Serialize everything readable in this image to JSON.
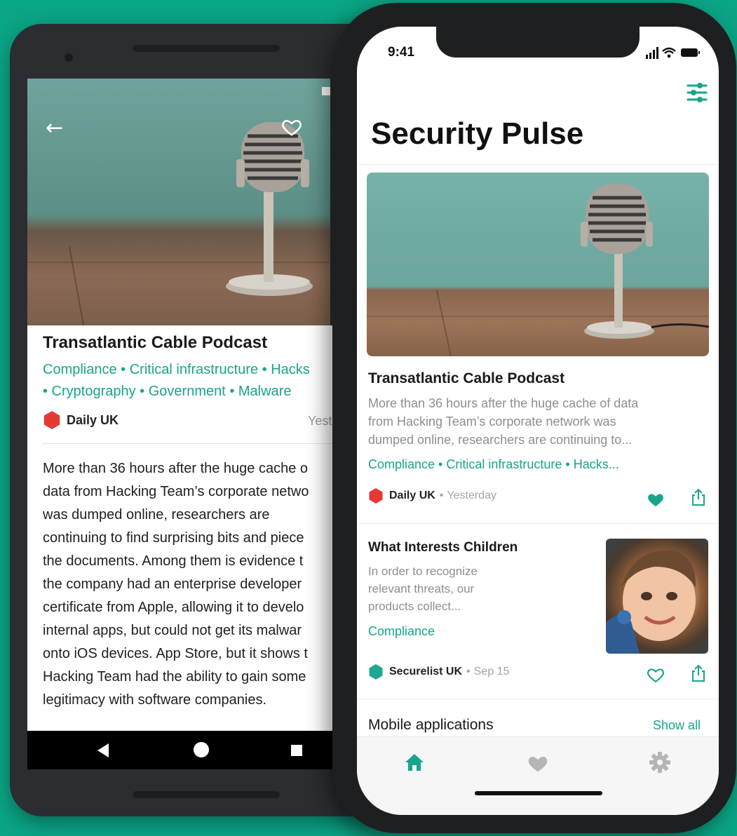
{
  "android": {
    "title": "Transatlantic Cable Podcast",
    "tags": [
      "Compliance • Critical infrastructure • Hacks",
      "• Cryptography • Government • Malware"
    ],
    "source": "Daily UK",
    "date": "Yeste",
    "body": [
      "More than 36 hours after the huge cache o",
      "data from Hacking Team’s corporate netwo",
      "was dumped online, researchers are",
      "continuing to find surprising bits and piece",
      "the documents. Among them is evidence t",
      "the company had an enterprise developer",
      "certificate from Apple, allowing it to develo",
      "internal apps, but could not get its malwar",
      "onto iOS devices. App Store, but it shows t",
      "Hacking Team had the ability to gain some",
      "legitimacy with software companies."
    ]
  },
  "iphone": {
    "status_time": "9:41",
    "app_title": "Security Pulse",
    "card1": {
      "title": "Transatlantic Cable Podcast",
      "desc": [
        "More than 36 hours after the huge cache of data",
        "from Hacking Team’s corporate network was",
        "dumped online, researchers are continuing to..."
      ],
      "tags": "Compliance • Critical infrastructure • Hacks...",
      "source": "Daily UK",
      "date": "Yesterday",
      "liked": true
    },
    "card2": {
      "title": "What Interests Children",
      "desc": [
        "In order to recognize",
        "relevant threats, our",
        "products collect..."
      ],
      "tag": "Compliance",
      "source": "Securelist UK",
      "date": "Sep 15",
      "liked": false
    },
    "section": {
      "title": "Mobile applications",
      "action": "Show all"
    },
    "tabs": [
      "home-icon",
      "heart-icon",
      "gear-icon"
    ]
  },
  "colors": {
    "background": "#0aa585",
    "accent": "#17a58a",
    "brand_red": "#e53935"
  }
}
